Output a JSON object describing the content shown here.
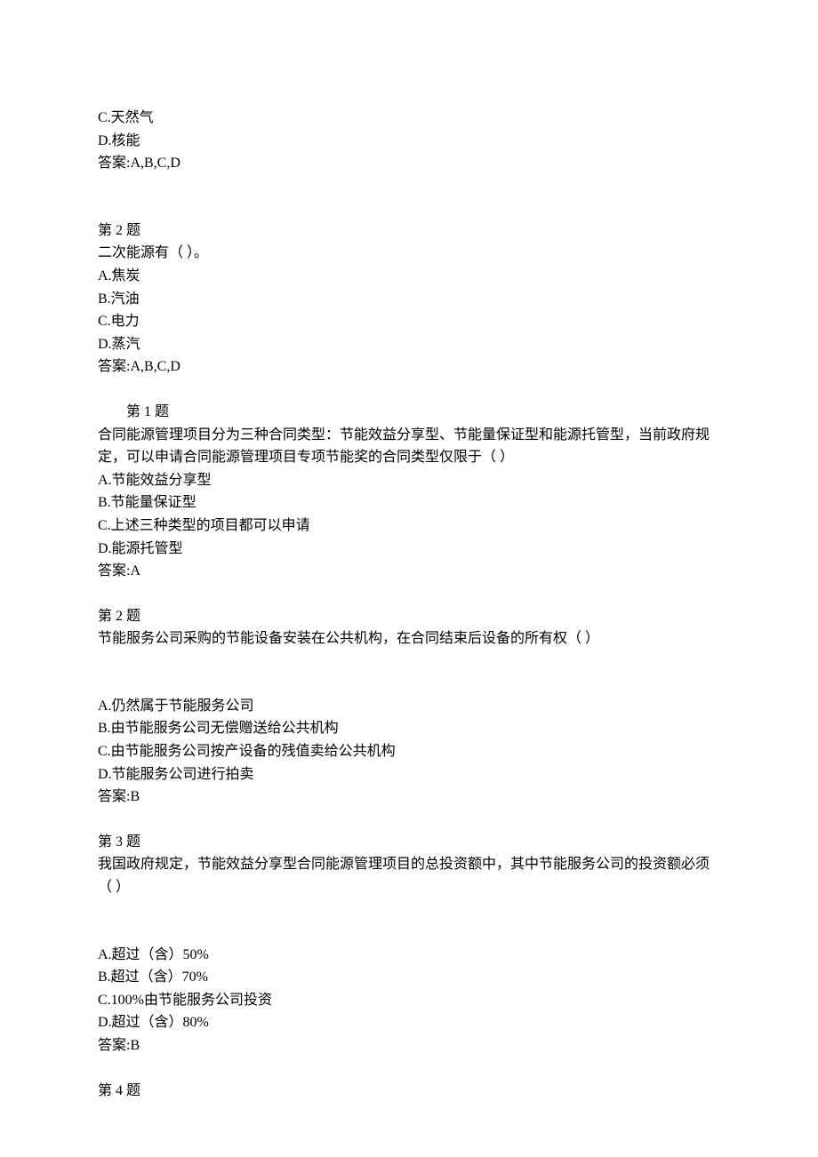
{
  "partial_q1": {
    "optC": "C.天然气",
    "optD": "D.核能",
    "answer": "答案:A,B,C,D"
  },
  "q2a": {
    "header": "第 2 题",
    "stem": "二次能源有（ ）。",
    "optA": "A.焦炭",
    "optB": "B.汽油",
    "optC": "C.电力",
    "optD": "D.蒸汽",
    "answer": "答案:A,B,C,D"
  },
  "q1b": {
    "header": "第 1 题",
    "stem": "合同能源管理项目分为三种合同类型：节能效益分享型、节能量保证型和能源托管型，当前政府规定，可以申请合同能源管理项目专项节能奖的合同类型仅限于（ ）",
    "optA": "A.节能效益分享型",
    "optB": "B.节能量保证型",
    "optC": "C.上述三种类型的项目都可以申请",
    "optD": "D.能源托管型",
    "answer": "答案:A"
  },
  "q2b": {
    "header": "第 2 题",
    "stem": "节能服务公司采购的节能设备安装在公共机构，在合同结束后设备的所有权（ ）",
    "optA": "A.仍然属于节能服务公司",
    "optB": "B.由节能服务公司无偿赠送给公共机构",
    "optC": "C.由节能服务公司按产设备的残值卖给公共机构",
    "optD": "D.节能服务公司进行拍卖",
    "answer": "答案:B"
  },
  "q3b": {
    "header": "第 3 题",
    "stem": "我国政府规定，节能效益分享型合同能源管理项目的总投资额中，其中节能服务公司的投资额必须（ ）",
    "optA": "A.超过（含）50%",
    "optB": "B.超过（含）70%",
    "optC": "C.100%由节能服务公司投资",
    "optD": "D.超过（含）80%",
    "answer": "答案:B"
  },
  "q4b": {
    "header": "第 4 题"
  }
}
